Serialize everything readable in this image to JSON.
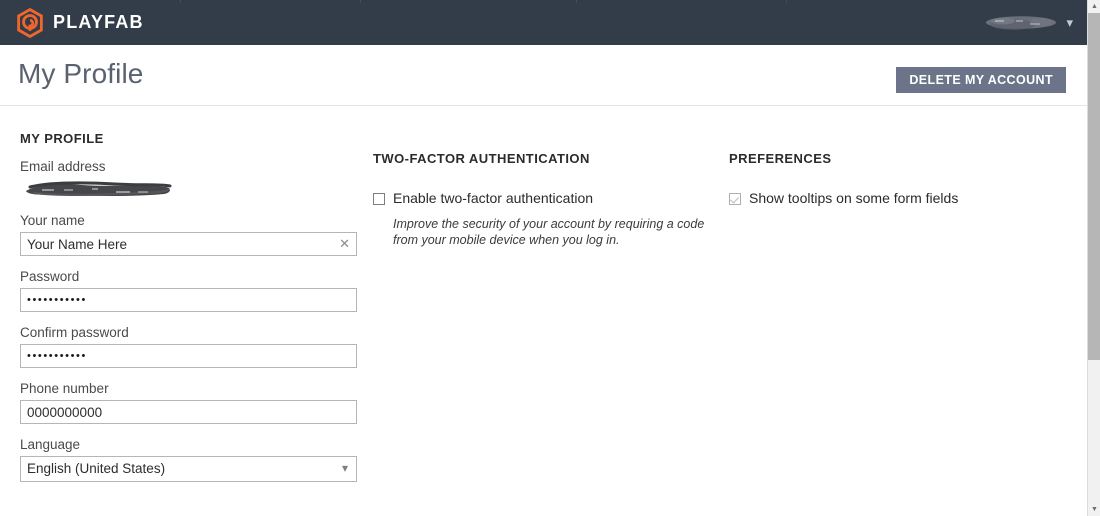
{
  "navbar": {
    "brand_name": "PLAYFAB",
    "brand_logo_icon": "playfab-hexagon-logo",
    "brand_color": "#f0662b",
    "background_color": "#333c49",
    "user_menu": {
      "redacted_label": "",
      "caret_icon": "chevron-down-icon"
    }
  },
  "page": {
    "title": "My Profile",
    "delete_button_label": "DELETE MY ACCOUNT",
    "delete_button_color": "#6b7489"
  },
  "profile": {
    "section_title": "MY PROFILE",
    "fields": {
      "email": {
        "label": "Email address",
        "value_redacted": true
      },
      "name": {
        "label": "Your name",
        "value": "Your Name Here",
        "clear_icon": "close-x-icon"
      },
      "password": {
        "label": "Password",
        "value": "•••••••••••"
      },
      "confirm_password": {
        "label": "Confirm password",
        "value": "•••••••••••"
      },
      "phone": {
        "label": "Phone number",
        "value": "0000000000"
      },
      "language": {
        "label": "Language",
        "value": "English (United States)",
        "caret_icon": "chevron-down-icon"
      }
    }
  },
  "two_factor": {
    "section_title": "TWO-FACTOR AUTHENTICATION",
    "enable_label": "Enable two-factor authentication",
    "enable_checked": false,
    "help_text": "Improve the security of your account by requiring a code from your mobile device when you log in."
  },
  "preferences": {
    "section_title": "PREFERENCES",
    "tooltips_label": "Show tooltips on some form fields",
    "tooltips_checked": true
  },
  "scrollbar": {
    "up_arrow": "▲",
    "down_arrow": "▼"
  }
}
